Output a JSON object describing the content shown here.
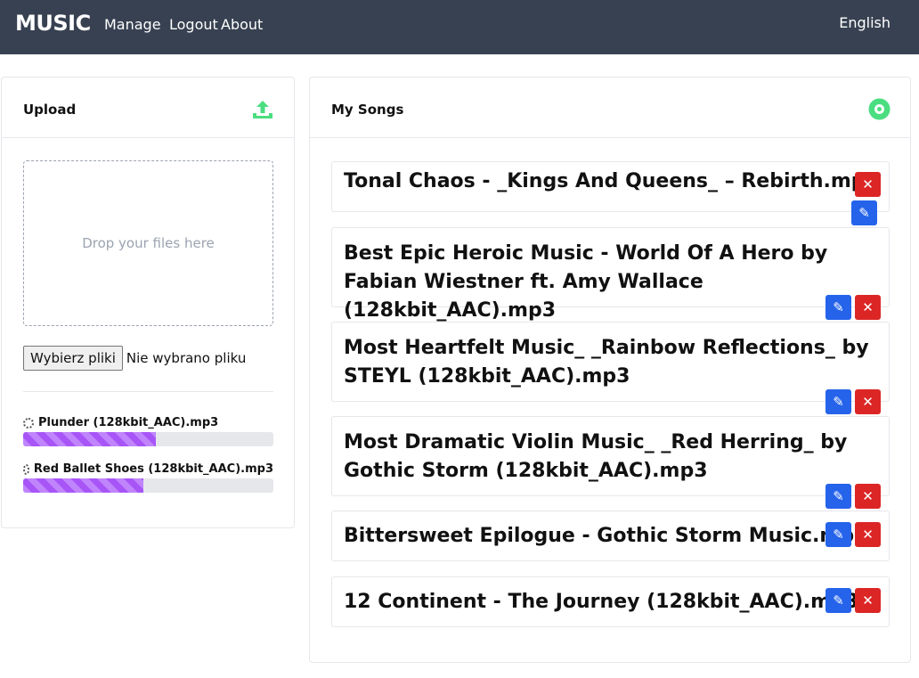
{
  "nav": {
    "brand": "MUSIC",
    "links": [
      "Manage",
      "Logout",
      "About"
    ],
    "language": "English"
  },
  "upload": {
    "title": "Upload",
    "dropzone_text": "Drop your files here",
    "file_button": "Wybierz pliki",
    "file_status": "Nie wybrano pliku",
    "items": [
      {
        "name": "Plunder (128kbit_AAC).mp3",
        "progress": 0.53
      },
      {
        "name": "Red Ballet Shoes (128kbit_AAC).mp3",
        "progress": 0.48
      }
    ]
  },
  "songs": {
    "title": "My Songs",
    "items": [
      {
        "title": "Tonal Chaos - _Kings And Queens_ – Rebirth.mp3"
      },
      {
        "title": "Best Epic Heroic Music - World Of A Hero by Fabian Wiestner ft. Amy Wallace (128kbit_AAC).mp3"
      },
      {
        "title": "Most Heartfelt Music_ _Rainbow Reflections_ by STEYL (128kbit_AAC).mp3"
      },
      {
        "title": "Most Dramatic Violin Music_ _Red Herring_ by Gothic Storm (128kbit_AAC).mp3"
      },
      {
        "title": "Bittersweet Epilogue - Gothic Storm Music.mp3"
      },
      {
        "title": "12 Continent - The Journey (128kbit_AAC).mp3"
      }
    ]
  },
  "colors": {
    "navbar": "#374151",
    "accent_green": "#4ade80",
    "delete_red": "#dc2626",
    "edit_blue": "#2563eb",
    "progress_purple": "#a855f7"
  },
  "icons": {
    "upload": "upload-icon",
    "songs": "disc-icon",
    "edit": "pencil-icon",
    "delete": "close-icon"
  }
}
